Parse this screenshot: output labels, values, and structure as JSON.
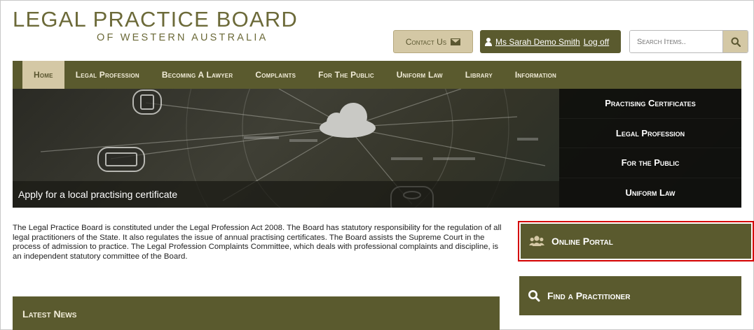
{
  "header": {
    "logo_line1": "LEGAL PRACTICE BOARD",
    "logo_line2": "OF WESTERN AUSTRALIA",
    "contact_label": "Contact Us",
    "user_name": "Ms Sarah Demo Smith",
    "logoff_label": "Log off",
    "search_placeholder": "Search Items.."
  },
  "nav": {
    "items": [
      {
        "label": "Home"
      },
      {
        "label": "Legal Profession"
      },
      {
        "label": "Becoming A Lawyer"
      },
      {
        "label": "Complaints"
      },
      {
        "label": "For The Public"
      },
      {
        "label": "Uniform Law"
      },
      {
        "label": "Library"
      },
      {
        "label": "Information"
      }
    ]
  },
  "hero": {
    "caption": "Apply for a local practising certificate",
    "side_items": [
      {
        "label": "Practising Certificates"
      },
      {
        "label": "Legal Profession"
      },
      {
        "label": "For the Public"
      },
      {
        "label": "Uniform Law"
      }
    ]
  },
  "main": {
    "intro": "The Legal Practice Board is constituted under the Legal Profession Act 2008. The Board has statutory responsibility for the regulation of all legal practitioners of the State. It also regulates the issue of annual practising certificates. The Board assists the Supreme Court in the process of admission to practice. The Legal Profession Complaints Committee, which deals with professional complaints and discipline, is an independent statutory committee of the Board.",
    "latest_news": "Latest News"
  },
  "sidebar": {
    "portal_label": "Online Portal",
    "find_label": "Find a Practitioner"
  },
  "colors": {
    "olive": "#5a5a2e",
    "tan": "#d4c8a5",
    "highlight": "#d40000"
  }
}
